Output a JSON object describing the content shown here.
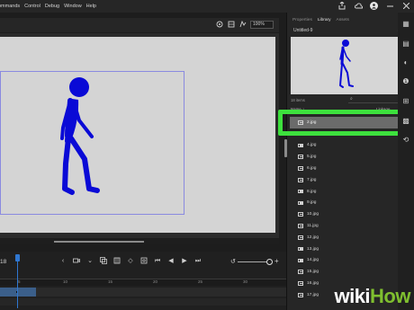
{
  "menubar": {
    "items": [
      "ommands",
      "Control",
      "Debug",
      "Window",
      "Help"
    ]
  },
  "stage": {
    "zoom": "100%"
  },
  "timeline": {
    "frame_number": "18",
    "ruler_marks": [
      "5",
      "10",
      "15",
      "20",
      "25",
      "30"
    ]
  },
  "panel": {
    "tabs": [
      "Properties",
      "Library",
      "Assets"
    ],
    "active_tab": "Library",
    "document": "Untitled-9",
    "item_count": "18 items",
    "columns": {
      "name": "Name",
      "linkage": "Linkage"
    },
    "items": [
      {
        "name": "2.jpg",
        "selected": true
      },
      {
        "name": "3.jpg"
      },
      {
        "name": "4.jpg"
      },
      {
        "name": "5.jpg"
      },
      {
        "name": "6.jpg"
      },
      {
        "name": "7.jpg"
      },
      {
        "name": "8.jpg"
      },
      {
        "name": "9.jpg"
      },
      {
        "name": "10.jpg"
      },
      {
        "name": "11.jpg"
      },
      {
        "name": "12.jpg"
      },
      {
        "name": "13.jpg"
      },
      {
        "name": "14.jpg"
      },
      {
        "name": "15.jpg"
      },
      {
        "name": "16.jpg"
      },
      {
        "name": "17.jpg"
      }
    ]
  },
  "watermark": {
    "part1": "wiki",
    "part2": "How"
  },
  "colors": {
    "figure": "#0a0ad6",
    "highlight": "#3de03d",
    "playhead": "#2f77d1",
    "wikihow_green": "#7fbf2f"
  },
  "icons": [
    "share-icon",
    "cloud-icon",
    "user-icon",
    "minimize-icon",
    "close-icon"
  ]
}
